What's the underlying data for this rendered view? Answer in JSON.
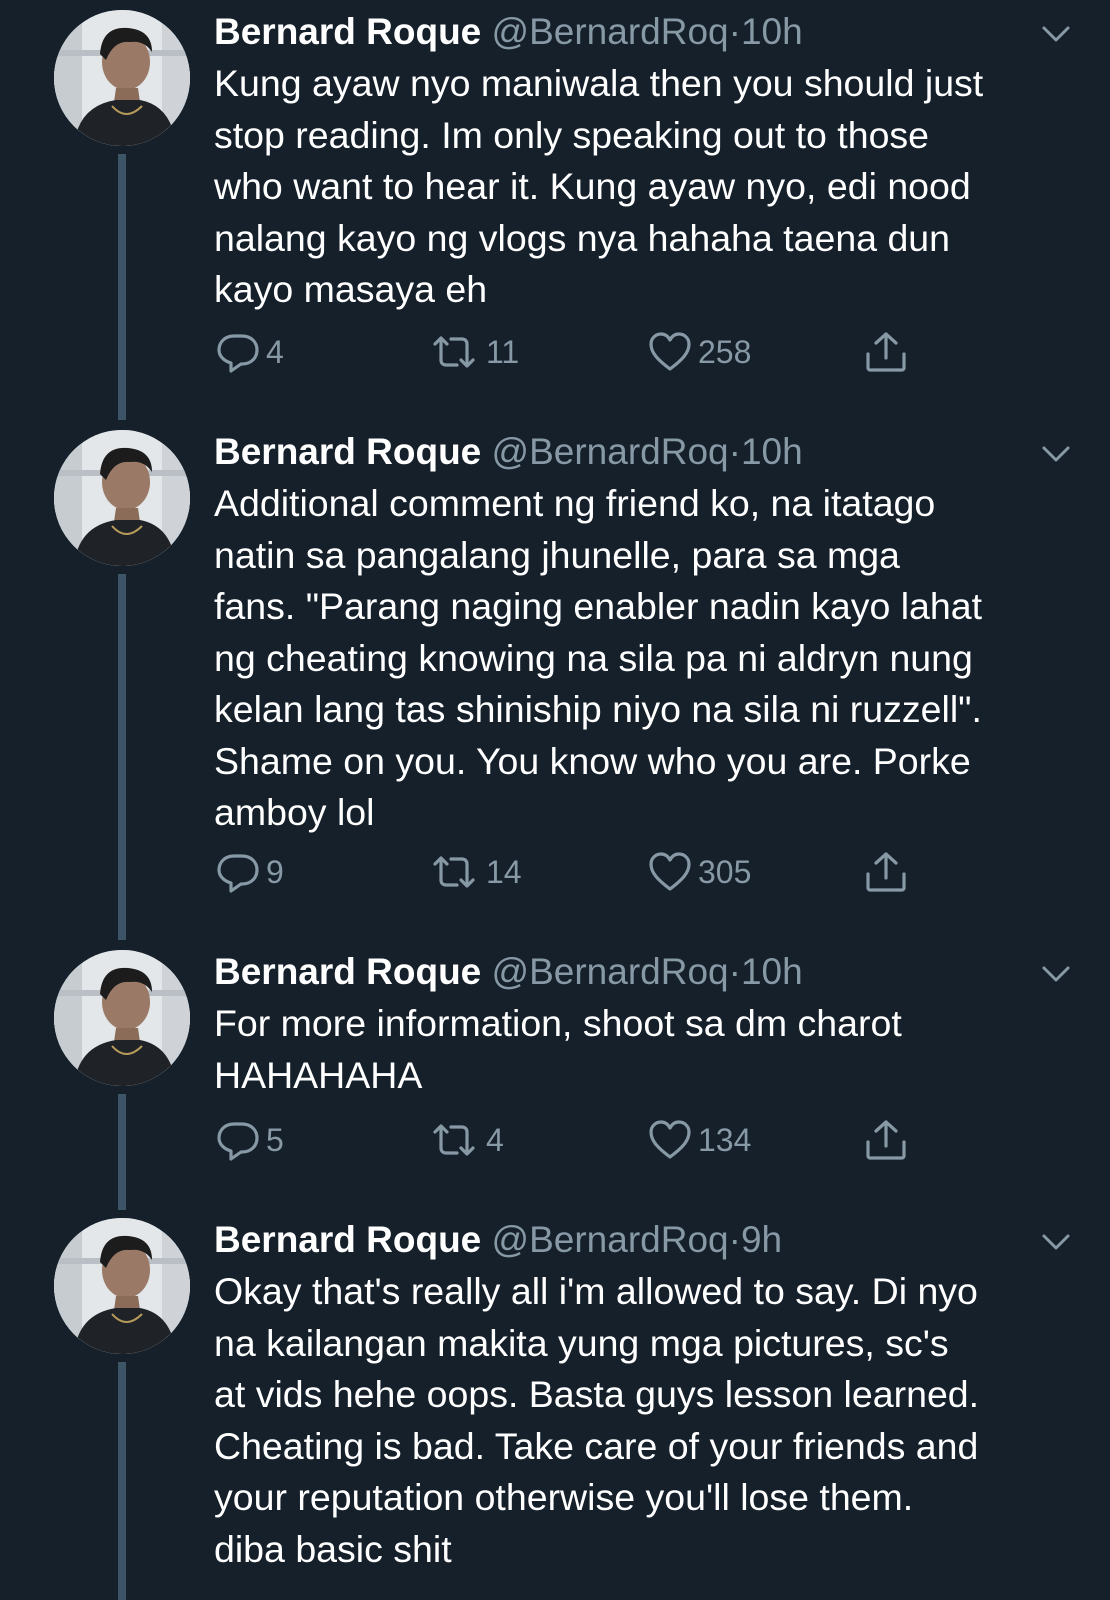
{
  "colors": {
    "background": "#15202b",
    "text": "#ffffff",
    "secondary": "#8899a6",
    "thread_line": "#3d5466"
  },
  "tweets": [
    {
      "name": "Bernard Roque",
      "handle": "@BernardRoq",
      "separator": "·",
      "time": "10h",
      "text": "Kung ayaw nyo maniwala then you should just\nstop reading. Im only speaking out to those\nwho want to hear it. Kung ayaw nyo, edi nood\nnalang kayo ng vlogs nya hahaha taena dun\nkayo masaya eh",
      "replies": "4",
      "retweets": "11",
      "likes": "258",
      "icons": [
        "reply-icon",
        "retweet-icon",
        "heart-icon",
        "share-icon"
      ]
    },
    {
      "name": "Bernard Roque",
      "handle": "@BernardRoq",
      "separator": "·",
      "time": "10h",
      "text": "Additional comment ng friend ko, na itatago\nnatin sa pangalang jhunelle, para sa mga\nfans. \"Parang naging enabler nadin kayo lahat\nng cheating knowing na sila pa ni aldryn nung\nkelan lang tas shiniship niyo na sila ni ruzzell\".\nShame on you. You know who you are. Porke\namboy lol",
      "replies": "9",
      "retweets": "14",
      "likes": "305",
      "icons": [
        "reply-icon",
        "retweet-icon",
        "heart-icon",
        "share-icon"
      ]
    },
    {
      "name": "Bernard Roque",
      "handle": "@BernardRoq",
      "separator": "·",
      "time": "10h",
      "text": "For more information, shoot sa dm charot\nHAHAHAHA",
      "replies": "5",
      "retweets": "4",
      "likes": "134",
      "icons": [
        "reply-icon",
        "retweet-icon",
        "heart-icon",
        "share-icon"
      ]
    },
    {
      "name": "Bernard Roque",
      "handle": "@BernardRoq",
      "separator": "·",
      "time": "9h",
      "text": "Okay that's really all i'm allowed to say. Di nyo\nna kailangan makita yung mga pictures, sc's\nat vids hehe oops. Basta guys lesson learned.\nCheating is bad. Take care of your friends and\nyour reputation otherwise you'll lose them.\ndiba basic shit"
    }
  ]
}
